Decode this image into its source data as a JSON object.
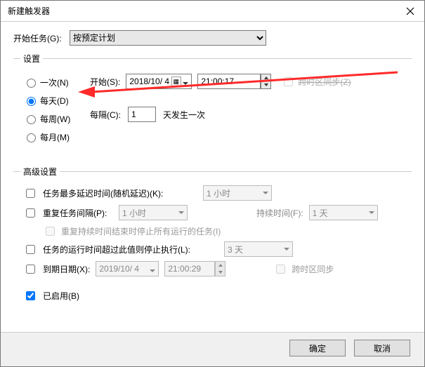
{
  "window": {
    "title": "新建触发器"
  },
  "task": {
    "label": "开始任务(G):",
    "value": "按预定计划"
  },
  "settings": {
    "legend": "设置",
    "freq": {
      "once": "一次(N)",
      "daily": "每天(D)",
      "weekly": "每周(W)",
      "monthly": "每月(M)"
    },
    "start": {
      "label": "开始(S):",
      "date": "2018/10/ 4",
      "time": "21:00:17",
      "timesync": "跨时区同步(Z)"
    },
    "interval": {
      "label": "每隔(C):",
      "value": "1",
      "suffix": "天发生一次"
    }
  },
  "advanced": {
    "legend": "高级设置",
    "delay": {
      "label": "任务最多延迟时间(随机延迟)(K):",
      "value": "1 小时"
    },
    "repeat": {
      "label": "重复任务间隔(P):",
      "value": "1 小时",
      "duration_label": "持续时间(F):",
      "duration_value": "1 天"
    },
    "repeat_sub": "重复持续时间结束时停止所有运行的任务(I)",
    "stop": {
      "label": "任务的运行时间超过此值则停止执行(L):",
      "value": "3 天"
    },
    "expire": {
      "label": "到期日期(X):",
      "date": "2019/10/ 4",
      "time": "21:00:29",
      "timesync": "跨时区同步"
    },
    "enabled": "已启用(B)"
  },
  "buttons": {
    "ok": "确定",
    "cancel": "取消"
  }
}
